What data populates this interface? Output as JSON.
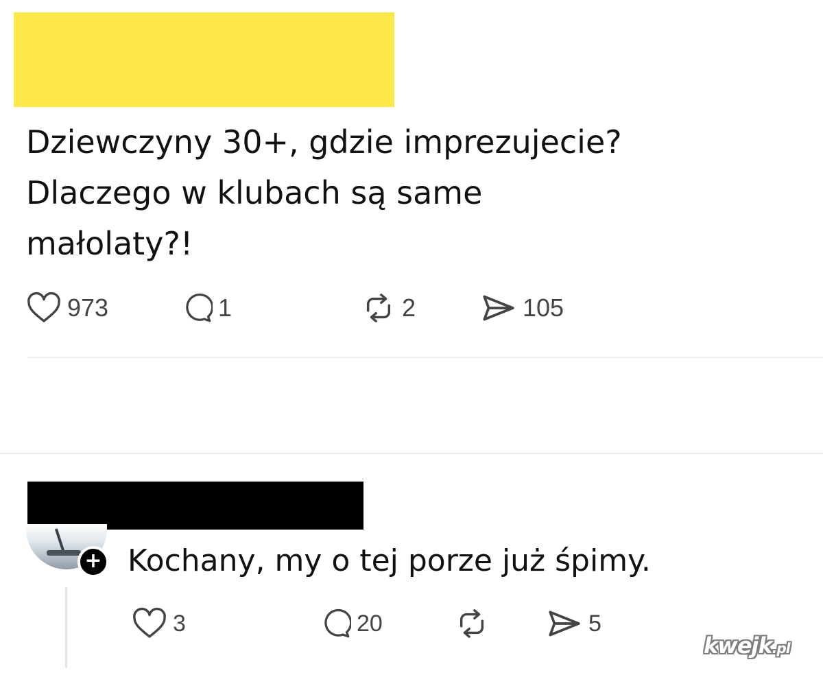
{
  "post": {
    "text_lines": [
      "Dziewczyny 30+, gdzie imprezujecie?",
      "Dlaczego w klubach są same",
      "małolaty?!"
    ],
    "actions": {
      "likes": "973",
      "replies": "1",
      "reposts": "2",
      "shares": "105"
    }
  },
  "reply": {
    "text": "Kochany, my o tej porze już śpimy.",
    "follow_symbol": "+",
    "actions": {
      "likes": "3",
      "replies": "20",
      "reposts": "",
      "shares": "5"
    }
  },
  "watermark": {
    "name": "kwejk",
    "suffix": ".pl"
  },
  "colors": {
    "redaction_yellow": "#fde84a",
    "redaction_black": "#000000",
    "icon_gray": "#444444"
  },
  "icons": [
    "heart-icon",
    "comment-icon",
    "repost-icon",
    "share-icon"
  ]
}
